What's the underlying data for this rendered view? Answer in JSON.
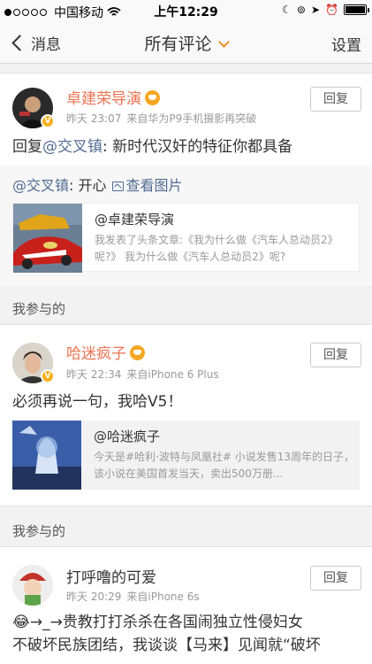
{
  "status_bar": {
    "carrier": "中国移动",
    "time": "上午12:29"
  },
  "nav": {
    "back_label": "消息",
    "title": "所有评论",
    "settings_label": "设置"
  },
  "comments": [
    {
      "username": "卓建荣导演",
      "time": "昨天 23:07",
      "source": "来自华为P9手机摄影再突破",
      "reply_label": "回复",
      "content_prefix": "回复",
      "mention": "@交叉镇",
      "content_text": ": 新时代汉奸的特征你都具备",
      "orig_mention": "@交叉镇",
      "orig_text": ": 开心",
      "orig_link": "查看图片",
      "share_title": "@卓建荣导演",
      "share_desc": "我发表了头条文章:《我为什么做《汽车人总动员2》呢?》 我为什么做《汽车人总动员2》呢?"
    },
    {
      "section_label": "我参与的",
      "username": "哈迷疯子",
      "time": "昨天 22:34",
      "source": "来自iPhone 6 Plus",
      "reply_label": "回复",
      "content_text": "必须再说一句，我哈V5！",
      "share_title": "@哈迷疯子",
      "share_desc": "今天是#哈利·波特与凤凰社# 小说发售13周年的日子，该小说在美国首发当天，卖出500万册..."
    },
    {
      "section_label": "我参与的",
      "username": "打呼噜的可爱",
      "time": "昨天 20:29",
      "source": "来自iPhone 6s",
      "reply_label": "回复",
      "content_line1": "→_→贵教打打杀杀在各国闹独立性侵妇女",
      "content_line2": "不破坏民族团结，我谈谈【马来】见闻就“破坏"
    }
  ],
  "colors": {
    "accent_orange": "#eb7350",
    "link_blue": "#526c93",
    "vip_gold": "#f6b21c"
  }
}
